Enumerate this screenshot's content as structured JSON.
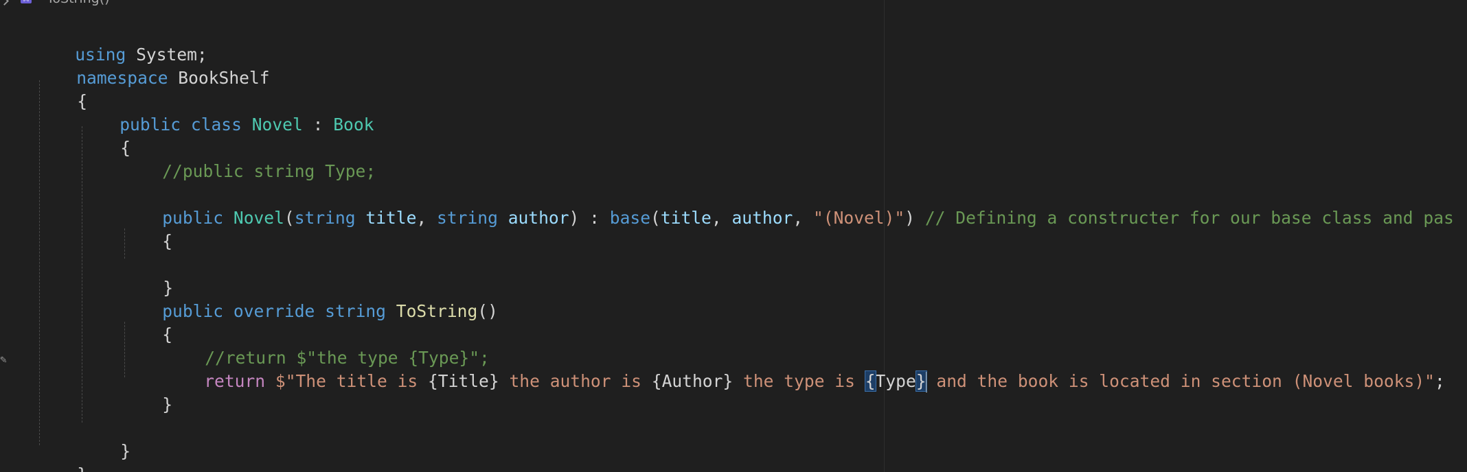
{
  "breadcrumb": {
    "method_label": "ToString()",
    "method_icon_text": "M"
  },
  "code": {
    "line1": {
      "kw": "using",
      "rest": " System;"
    },
    "line2": {
      "kw": "namespace",
      "rest": " BookShelf"
    },
    "line3": {
      "text": "{"
    },
    "line4": {
      "public": "public",
      "class": " class ",
      "name": "Novel",
      "colon": " : ",
      "base": "Book"
    },
    "line5": {
      "text": "{"
    },
    "line6": {
      "comment": "//public string Type;"
    },
    "line8": {
      "public": "public",
      "name": " Novel",
      "open": "(",
      "string1": "string",
      "p1": " title",
      "comma1": ", ",
      "string2": "string",
      "p2": " author",
      "close": ") : ",
      "base": "base",
      "open2": "(",
      "a1": "title",
      "comma2": ", ",
      "a2": "author",
      "comma3": ", ",
      "strlit": "\"(Novel)\"",
      "close2": ") ",
      "comment": "// Defining a constructer for our base class and pas"
    },
    "line9": {
      "text": "{"
    },
    "line11": {
      "text": "}"
    },
    "line12": {
      "public": "public",
      "override": " override",
      "string": " string",
      "fn": " ToString",
      "parens": "()"
    },
    "line13": {
      "text": "{"
    },
    "line14": {
      "comment": "//return $\"the type {Type}\";"
    },
    "line15": {
      "return": "return",
      "s1": " $\"The title is ",
      "i1": "{Title}",
      "s2": " the author is ",
      "i2": "{Author}",
      "s3": " the type is ",
      "i3open": "{",
      "i3name": "Type",
      "i3close": "}",
      "s4": " and the book is located in section (Novel books)\"",
      "semi": ";"
    },
    "line16": {
      "text": "}"
    },
    "line18": {
      "text": "}"
    },
    "line19": {
      "text": "}"
    }
  },
  "colors": {
    "background": "#1f1f1f",
    "keyword": "#569cd6",
    "control_keyword": "#c586c0",
    "type": "#4ec9b0",
    "function": "#dcdcaa",
    "parameter": "#9cdcfe",
    "string": "#ce9178",
    "comment": "#6a9955"
  },
  "icons": {
    "breadcrumb_chevron": "chevron-right-icon",
    "method": "method-icon",
    "gutter_edit": "pencil-icon"
  }
}
